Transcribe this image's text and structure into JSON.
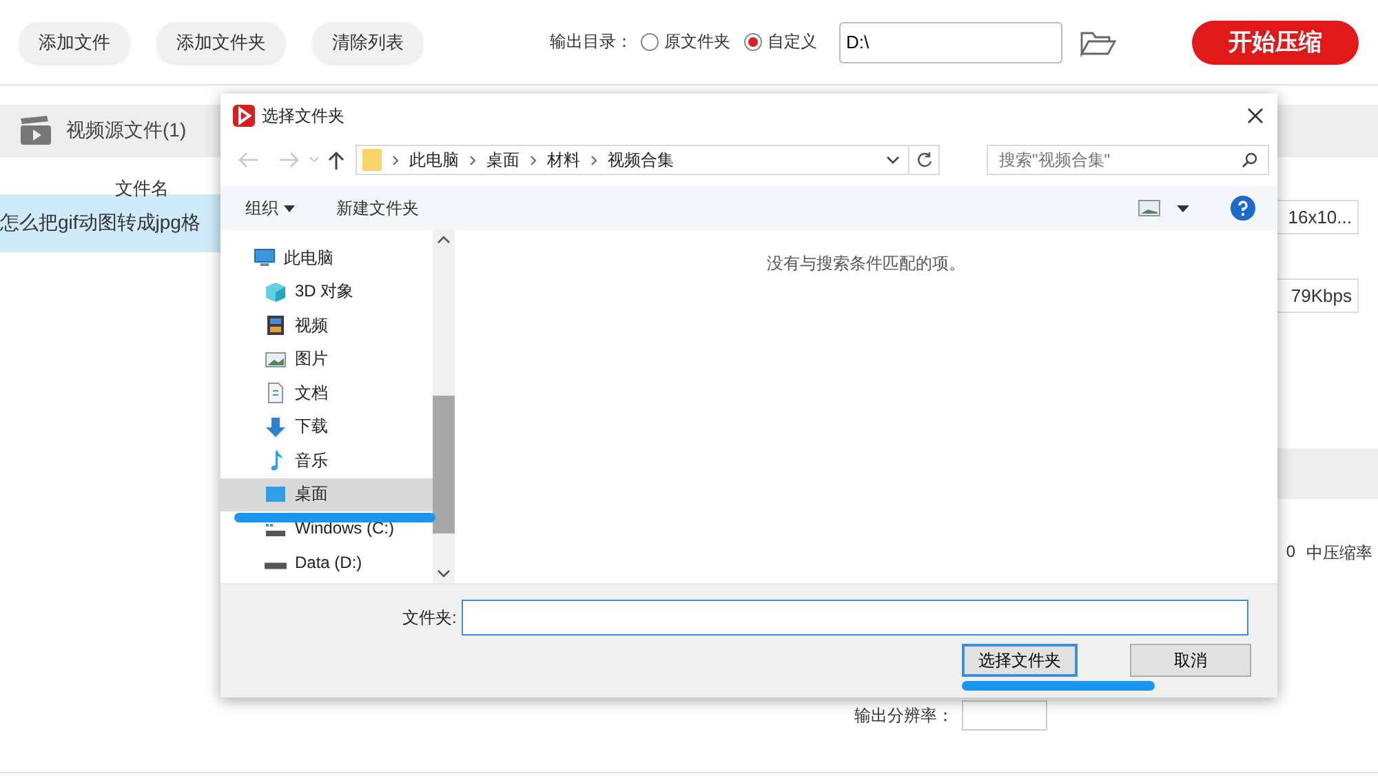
{
  "toolbar": {
    "buttons": [
      "添加文件",
      "添加文件夹",
      "清除列表"
    ],
    "output_label": "输出目录：",
    "output_options": [
      {
        "label": "原文件夹",
        "selected": false
      },
      {
        "label": "自定义",
        "selected": true
      }
    ],
    "output_path": "D:\\",
    "start_button": "开始压缩"
  },
  "section": {
    "title": "视频源文件(1)"
  },
  "file_list": {
    "column": "文件名",
    "rows": [
      {
        "name": "怎么把gif动图转成jpg格",
        "selected": true
      }
    ]
  },
  "settings": {
    "resolution_box": "16x10...",
    "bitrate_box": "79Kbps",
    "compression_value": "0",
    "compression_label": "中压缩率",
    "resolution_label": "输出分辨率："
  },
  "dialog": {
    "title": "选择文件夹",
    "breadcrumbs": [
      "此电脑",
      "桌面",
      "材料",
      "视频合集"
    ],
    "search": {
      "placeholder": "搜索\"视频合集\""
    },
    "commands": [
      "组织",
      "新建文件夹"
    ],
    "tree": [
      {
        "label": "此电脑",
        "kind": "computer",
        "selected": false,
        "children": [
          {
            "label": "3D 对象",
            "kind": "objects",
            "selected": false
          },
          {
            "label": "视频",
            "kind": "video",
            "selected": false
          },
          {
            "label": "图片",
            "kind": "pictures",
            "selected": false
          },
          {
            "label": "文档",
            "kind": "documents",
            "selected": false
          },
          {
            "label": "下载",
            "kind": "downloads",
            "selected": false
          },
          {
            "label": "音乐",
            "kind": "music",
            "selected": false
          },
          {
            "label": "桌面",
            "kind": "desktop",
            "selected": true
          },
          {
            "label": "Windows (C:)",
            "kind": "system-drive",
            "selected": false
          },
          {
            "label": "Data (D:)",
            "kind": "drive",
            "selected": false
          }
        ]
      }
    ],
    "empty_message": "没有与搜索条件匹配的项。",
    "folder_label": "文件夹:",
    "confirm_button": "选择文件夹",
    "cancel_button": "取消"
  }
}
